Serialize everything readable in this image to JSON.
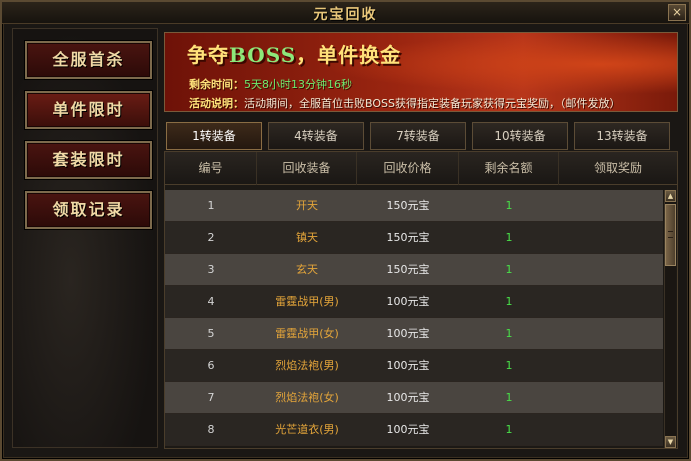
{
  "window": {
    "title": "元宝回收",
    "close_label": "×"
  },
  "sidebar": {
    "items": [
      {
        "label": "全服首杀"
      },
      {
        "label": "单件限时"
      },
      {
        "label": "套装限时"
      },
      {
        "label": "领取记录"
      }
    ]
  },
  "banner": {
    "headline_a": "争夺",
    "headline_boss": "BOSS",
    "headline_b": "，单件换金",
    "time_label": "剩余时间：",
    "time_value": "5天8小时13分钟16秒",
    "desc_label": "活动说明：",
    "desc_text": "活动期间，全服首位击败BOSS获得指定装备玩家获得元宝奖励，（邮件发放）"
  },
  "tabs": [
    {
      "label": "1转装备"
    },
    {
      "label": "4转装备"
    },
    {
      "label": "7转装备"
    },
    {
      "label": "10转装备"
    },
    {
      "label": "13转装备"
    }
  ],
  "table": {
    "headers": [
      "编号",
      "回收装备",
      "回收价格",
      "剩余名额",
      "领取奖励"
    ],
    "rows": [
      {
        "id": "1",
        "name": "开天",
        "price": "150元宝",
        "remaining": "1"
      },
      {
        "id": "2",
        "name": "镇天",
        "price": "150元宝",
        "remaining": "1"
      },
      {
        "id": "3",
        "name": "玄天",
        "price": "150元宝",
        "remaining": "1"
      },
      {
        "id": "4",
        "name": "雷霆战甲(男)",
        "price": "100元宝",
        "remaining": "1"
      },
      {
        "id": "5",
        "name": "雷霆战甲(女)",
        "price": "100元宝",
        "remaining": "1"
      },
      {
        "id": "6",
        "name": "烈焰法袍(男)",
        "price": "100元宝",
        "remaining": "1"
      },
      {
        "id": "7",
        "name": "烈焰法袍(女)",
        "price": "100元宝",
        "remaining": "1"
      },
      {
        "id": "8",
        "name": "光芒道衣(男)",
        "price": "100元宝",
        "remaining": "1"
      }
    ]
  },
  "scrollbar": {
    "up_icon": "▲",
    "down_icon": "▼"
  }
}
